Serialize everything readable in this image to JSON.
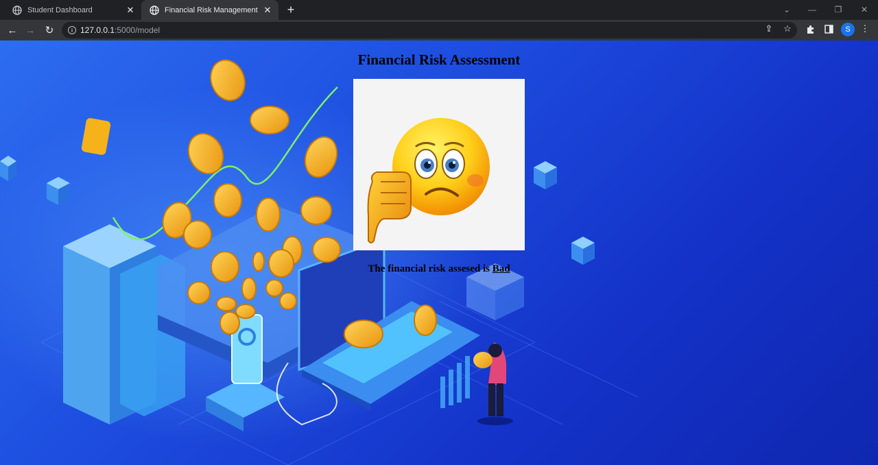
{
  "browser": {
    "tabs": [
      {
        "label": "Student Dashboard",
        "active": false
      },
      {
        "label": "Financial Risk Management",
        "active": true
      }
    ],
    "url_host": "127.0.0.1",
    "url_path": ":5000/model",
    "profile_initial": "S"
  },
  "page": {
    "title": "Financial Risk Assessment",
    "result_prefix": "The financial risk assesed is",
    "result_value": "Bad",
    "image": "thumbs-down-sad-emoji"
  },
  "colors": {
    "background": "#1e4fe0",
    "coin": "#f5b21b",
    "text": "#000000"
  }
}
